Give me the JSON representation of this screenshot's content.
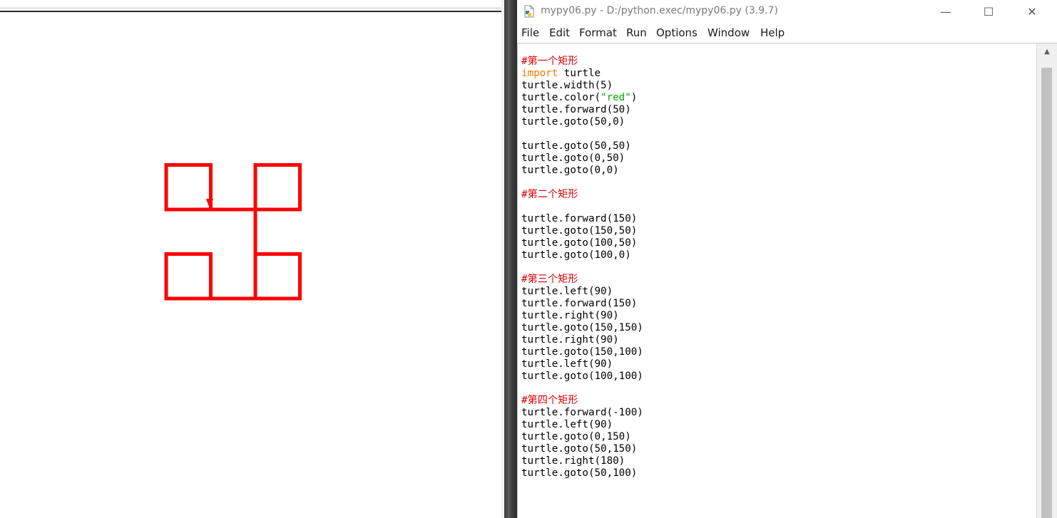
{
  "turtle": {
    "pen_color": "#ff0000"
  },
  "editor": {
    "title": "mypy06.py - D:/python.exec/mypy06.py (3.9.7)",
    "icon": "python-file-icon",
    "window_buttons": {
      "minimize": "—",
      "maximize": "☐",
      "close": "✕"
    },
    "menu": [
      "File",
      "Edit",
      "Format",
      "Run",
      "Options",
      "Window",
      "Help"
    ],
    "code_lines": [
      [
        {
          "t": "#第一个矩形",
          "c": "comment"
        }
      ],
      [
        {
          "t": "import",
          "c": "keyword"
        },
        {
          "t": " turtle",
          "c": "plain"
        }
      ],
      [
        {
          "t": "turtle.width(5)",
          "c": "plain"
        }
      ],
      [
        {
          "t": "turtle.color(",
          "c": "plain"
        },
        {
          "t": "\"red\"",
          "c": "string"
        },
        {
          "t": ")",
          "c": "plain"
        }
      ],
      [
        {
          "t": "turtle.forward(50)",
          "c": "plain"
        }
      ],
      [
        {
          "t": "turtle.goto(50,0)",
          "c": "plain"
        }
      ],
      [],
      [
        {
          "t": "turtle.goto(50,50)",
          "c": "plain"
        }
      ],
      [
        {
          "t": "turtle.goto(0,50)",
          "c": "plain"
        }
      ],
      [
        {
          "t": "turtle.goto(0,0)",
          "c": "plain"
        }
      ],
      [],
      [
        {
          "t": "#第二个矩形",
          "c": "comment"
        }
      ],
      [],
      [
        {
          "t": "turtle.forward(150)",
          "c": "plain"
        }
      ],
      [
        {
          "t": "turtle.goto(150,50)",
          "c": "plain"
        }
      ],
      [
        {
          "t": "turtle.goto(100,50)",
          "c": "plain"
        }
      ],
      [
        {
          "t": "turtle.goto(100,0)",
          "c": "plain"
        }
      ],
      [],
      [
        {
          "t": "#第三个矩形",
          "c": "comment"
        }
      ],
      [
        {
          "t": "turtle.left(90)",
          "c": "plain"
        }
      ],
      [
        {
          "t": "turtle.forward(150)",
          "c": "plain"
        }
      ],
      [
        {
          "t": "turtle.right(90)",
          "c": "plain"
        }
      ],
      [
        {
          "t": "turtle.goto(150,150)",
          "c": "plain"
        }
      ],
      [
        {
          "t": "turtle.right(90)",
          "c": "plain"
        }
      ],
      [
        {
          "t": "turtle.goto(150,100)",
          "c": "plain"
        }
      ],
      [
        {
          "t": "turtle.left(90)",
          "c": "plain"
        }
      ],
      [
        {
          "t": "turtle.goto(100,100)",
          "c": "plain"
        }
      ],
      [],
      [
        {
          "t": "#第四个矩形",
          "c": "comment"
        }
      ],
      [
        {
          "t": "turtle.forward(-100)",
          "c": "plain"
        }
      ],
      [
        {
          "t": "turtle.left(90)",
          "c": "plain"
        }
      ],
      [
        {
          "t": "turtle.goto(0,150)",
          "c": "plain"
        }
      ],
      [
        {
          "t": "turtle.goto(50,150)",
          "c": "plain"
        }
      ],
      [
        {
          "t": "turtle.right(180)",
          "c": "plain"
        }
      ],
      [
        {
          "t": "turtle.goto(50,100)",
          "c": "plain"
        }
      ]
    ]
  }
}
